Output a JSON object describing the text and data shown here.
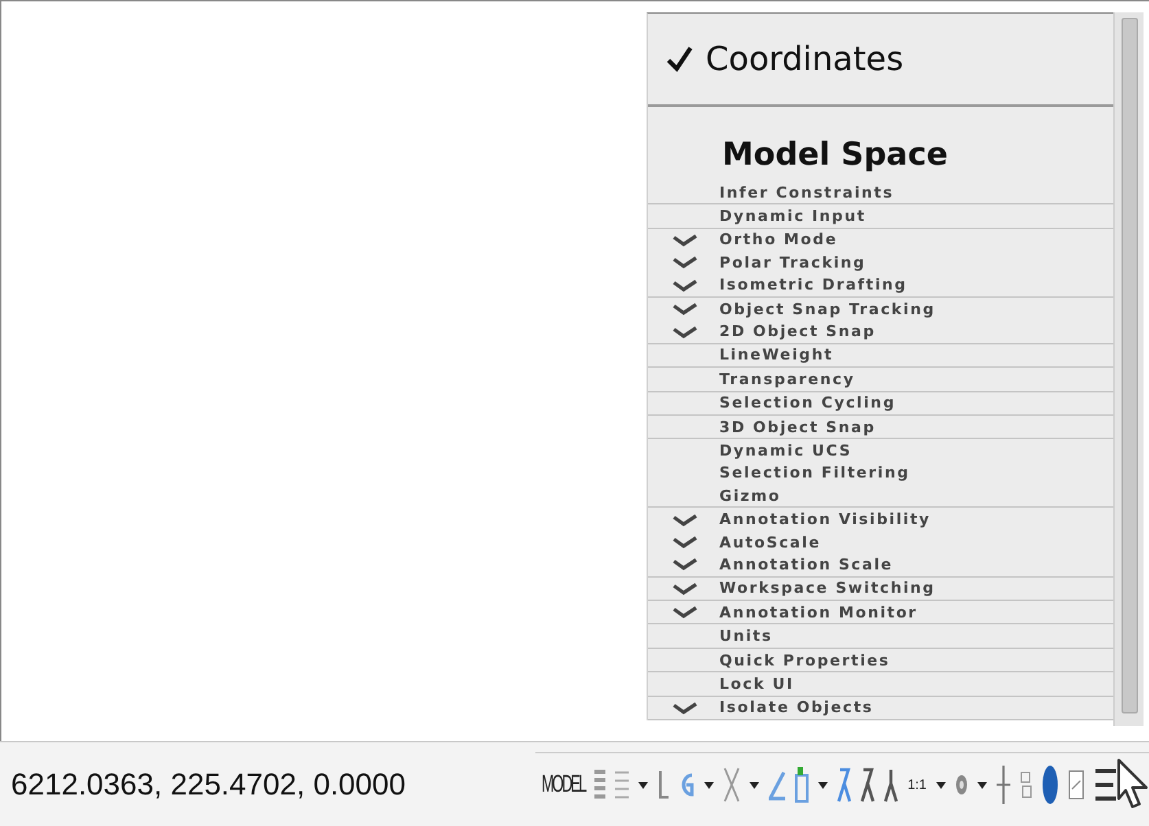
{
  "menu": {
    "header": {
      "label": "Coordinates",
      "checked": true
    },
    "section_title": "Model Space",
    "groups": [
      {
        "items": [
          {
            "label": "Infer Constraints",
            "checked": false
          }
        ]
      },
      {
        "items": [
          {
            "label": "Dynamic Input",
            "checked": false
          }
        ]
      },
      {
        "items": [
          {
            "label": "Ortho Mode",
            "checked": true
          },
          {
            "label": "Polar Tracking",
            "checked": true
          },
          {
            "label": "Isometric Drafting",
            "checked": true
          }
        ]
      },
      {
        "items": [
          {
            "label": "Object Snap Tracking",
            "checked": true
          },
          {
            "label": "2D Object Snap",
            "checked": true
          }
        ]
      },
      {
        "items": [
          {
            "label": "LineWeight",
            "checked": false
          }
        ]
      },
      {
        "items": [
          {
            "label": "Transparency",
            "checked": false
          }
        ]
      },
      {
        "items": [
          {
            "label": "Selection Cycling",
            "checked": false
          }
        ]
      },
      {
        "items": [
          {
            "label": "3D Object Snap",
            "checked": false
          }
        ]
      },
      {
        "items": [
          {
            "label": "Dynamic UCS",
            "checked": false
          },
          {
            "label": "Selection Filtering",
            "checked": false
          },
          {
            "label": "Gizmo",
            "checked": false
          }
        ]
      },
      {
        "items": [
          {
            "label": "Annotation Visibility",
            "checked": true
          },
          {
            "label": "AutoScale",
            "checked": true
          },
          {
            "label": "Annotation Scale",
            "checked": true
          }
        ]
      },
      {
        "items": [
          {
            "label": "Workspace Switching",
            "checked": true
          }
        ]
      },
      {
        "items": [
          {
            "label": "Annotation Monitor",
            "checked": true
          }
        ]
      },
      {
        "items": [
          {
            "label": "Units",
            "checked": false
          }
        ]
      },
      {
        "items": [
          {
            "label": "Quick Properties",
            "checked": false
          }
        ]
      },
      {
        "items": [
          {
            "label": "Lock UI",
            "checked": false
          }
        ]
      },
      {
        "items": [
          {
            "label": "Isolate Objects",
            "checked": true
          }
        ]
      }
    ]
  },
  "status_bar": {
    "coordinates": "6212.0363, 225.4702, 0.0000",
    "model_label": "MODEL",
    "scale_label": "1:1"
  }
}
